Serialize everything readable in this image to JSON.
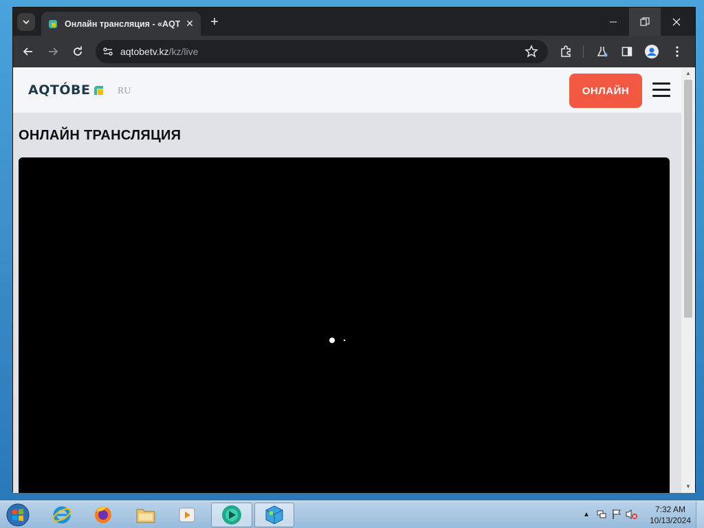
{
  "browser": {
    "tab_title": "Онлайн трансляция - «AQTÓBE",
    "url_host": "aqtobetv.kz",
    "url_path": "/kz/live"
  },
  "site": {
    "logo_text": "AQTÓBE",
    "lang": "RU",
    "live_button": "ОНЛАЙН",
    "page_title": "ОНЛАЙН ТРАНСЛЯЦИЯ"
  },
  "taskbar": {
    "time": "7:32 AM",
    "date": "10/13/2024"
  },
  "colors": {
    "accent": "#f35842",
    "logo_mark": "#e6c200"
  }
}
